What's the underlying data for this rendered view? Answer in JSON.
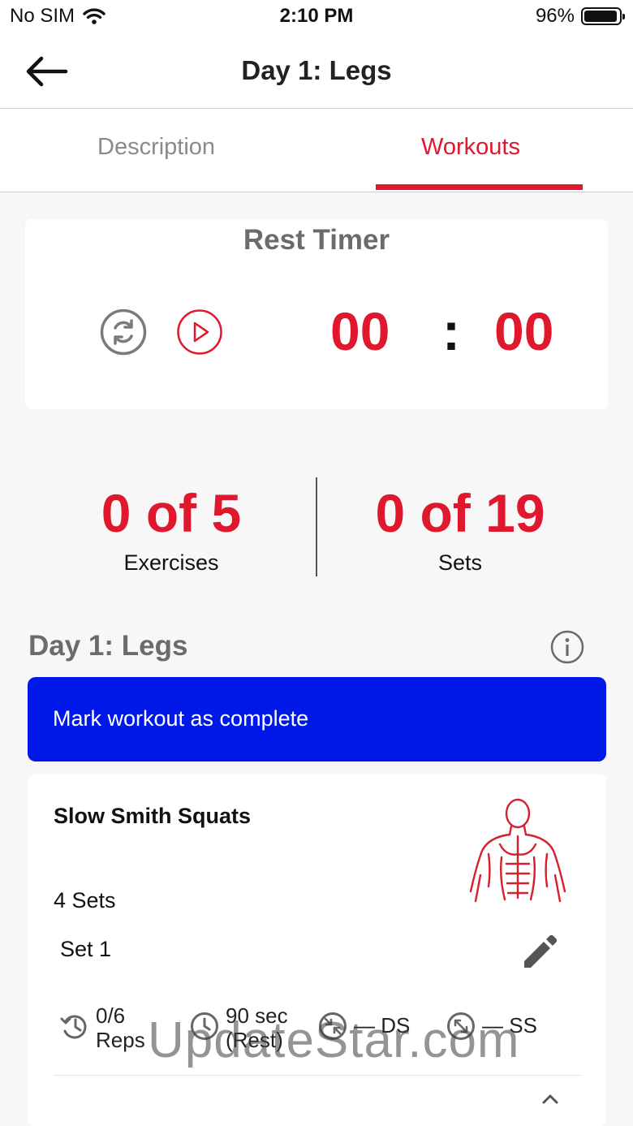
{
  "status_bar": {
    "carrier": "No SIM",
    "time": "2:10 PM",
    "battery": "96%",
    "battery_level": 0.96
  },
  "nav": {
    "title": "Day 1: Legs"
  },
  "tabs": [
    {
      "label": "Description",
      "active": false
    },
    {
      "label": "Workouts",
      "active": true
    }
  ],
  "timer": {
    "title": "Rest Timer",
    "minutes": "00",
    "separator": ":",
    "seconds": "00"
  },
  "stats": {
    "exercises": {
      "value": "0 of 5",
      "label": "Exercises"
    },
    "sets": {
      "value": "0 of 19",
      "label": "Sets"
    }
  },
  "section": {
    "title": "Day 1: Legs"
  },
  "complete_button": {
    "label": "Mark workout as complete"
  },
  "exercise": {
    "name": "Slow Smith Squats",
    "sets_count": "4 Sets",
    "set_label": "Set 1",
    "reps_value": "0/6",
    "reps_label": "Reps",
    "rest_value": "90 sec",
    "rest_label": "(Rest)",
    "ds_label": "— DS",
    "ss_label": "— SS"
  },
  "watermark": "UpdateStar.com",
  "colors": {
    "accent": "#e0182d",
    "primary_button": "#0018e8",
    "muted_text": "#6b6b6b",
    "tab_inactive": "#8a8a8a"
  },
  "icons": [
    "back-arrow-icon",
    "wifi-icon",
    "battery-icon",
    "reset-icon",
    "play-icon",
    "info-icon",
    "muscle-figure-icon",
    "pencil-icon",
    "history-icon",
    "clock-icon",
    "compress-icon",
    "expand-icon",
    "chevron-up-icon"
  ]
}
